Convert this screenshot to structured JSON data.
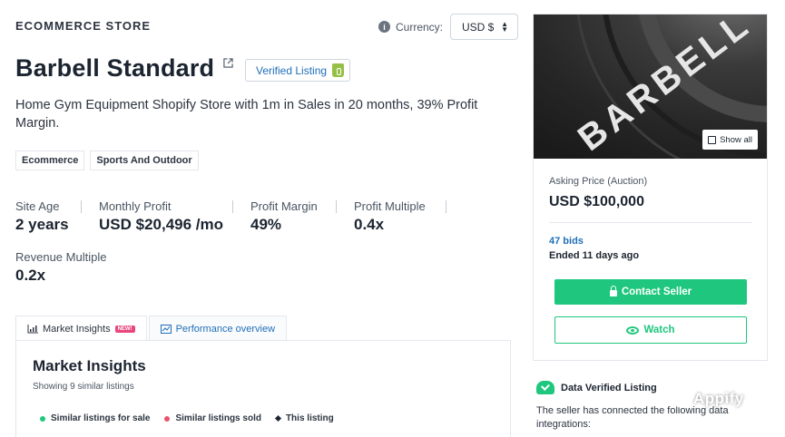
{
  "header": {
    "store_label": "ECOMMERCE STORE",
    "currency_label": "Currency:",
    "currency_value": "USD $"
  },
  "listing": {
    "title": "Barbell Standard",
    "verified_label": "Verified Listing",
    "subtitle": "Home Gym Equipment Shopify Store with 1m in Sales in 20 months, 39% Profit Margin.",
    "tags": [
      "Ecommerce",
      "Sports And Outdoor"
    ]
  },
  "metrics": [
    {
      "label": "Site Age",
      "value": "2 years"
    },
    {
      "label": "Monthly Profit",
      "value": "USD $20,496 /mo"
    },
    {
      "label": "Profit Margin",
      "value": "49%"
    },
    {
      "label": "Profit Multiple",
      "value": "0.4x"
    },
    {
      "label": "Revenue Multiple",
      "value": "0.2x"
    }
  ],
  "tabs": [
    {
      "label": "Market Insights",
      "badge": "NEW!"
    },
    {
      "label": "Performance overview"
    }
  ],
  "insights": {
    "title": "Market Insights",
    "subtitle": "Showing 9 similar listings",
    "legend": [
      {
        "label": "Similar listings for sale",
        "color": "#1ec77d"
      },
      {
        "label": "Similar listings sold",
        "color": "#e8536b"
      },
      {
        "label": "This listing",
        "color": "#1b2430"
      }
    ]
  },
  "card": {
    "image_text": "BARBELL",
    "show_all": "Show all",
    "asking_label": "Asking Price (Auction)",
    "asking_value": "USD $100,000",
    "bids": "47 bids",
    "ended": "Ended 11 days ago",
    "contact_button": "Contact Seller",
    "watch_button": "Watch"
  },
  "data_verified": {
    "title": "Data Verified Listing",
    "text": "The seller has connected the following data integrations:"
  },
  "watermark": "Appify",
  "colors": {
    "accent_green": "#1ec77d",
    "link_blue": "#1f6fb8",
    "new_badge": "#e8467c"
  }
}
